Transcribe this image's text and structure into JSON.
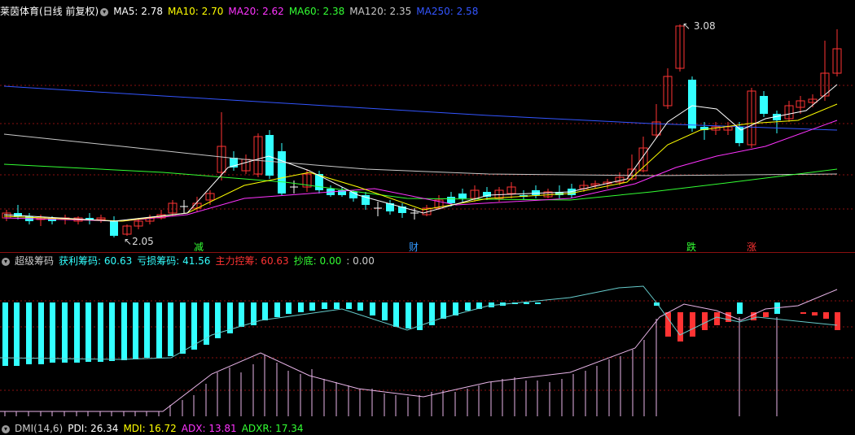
{
  "main_header": {
    "title": "莱茵体育(日线 前复权)",
    "ma": [
      {
        "label": "MA5: 2.78",
        "color": "#ffffff"
      },
      {
        "label": "MA10: 2.70",
        "color": "#ffff00"
      },
      {
        "label": "MA20: 2.62",
        "color": "#ff33ff"
      },
      {
        "label": "MA60: 2.38",
        "color": "#33ff33"
      },
      {
        "label": "MA120: 2.35",
        "color": "#c8c8c8"
      },
      {
        "label": "MA250: 2.58",
        "color": "#3355ff"
      }
    ]
  },
  "price_panel": {
    "high_label": "3.08",
    "low_label": "2.05",
    "markers": [
      {
        "text": "减",
        "color": "#33ff33"
      },
      {
        "text": "财",
        "color": "#3399ff"
      },
      {
        "text": "跌",
        "color": "#33ff33"
      },
      {
        "text": "涨",
        "color": "#ff3333"
      }
    ]
  },
  "indicator_header": {
    "title": "超级筹码",
    "items": [
      {
        "label": "获利筹码: 60.63",
        "color": "#33ffff"
      },
      {
        "label": "亏损筹码: 41.56",
        "color": "#33ffff"
      },
      {
        "label": "主力控筹: 60.63",
        "color": "#ff3333"
      },
      {
        "label": "抄底: 0.00",
        "color": "#33ff33"
      },
      {
        "label": ": 0.00",
        "color": "#cccccc"
      }
    ]
  },
  "dmi_header": {
    "items": [
      {
        "label": "DMI(14,6)",
        "color": "#cccccc"
      },
      {
        "label": "PDI: 26.34",
        "color": "#ffffff"
      },
      {
        "label": "MDI: 16.72",
        "color": "#ffff00"
      },
      {
        "label": "ADX: 13.81",
        "color": "#ff33ff"
      },
      {
        "label": "ADXR: 17.34",
        "color": "#33ff33"
      }
    ]
  },
  "colors": {
    "up": "#ff3333",
    "down": "#33ffff",
    "grid": "#8a1010"
  }
}
